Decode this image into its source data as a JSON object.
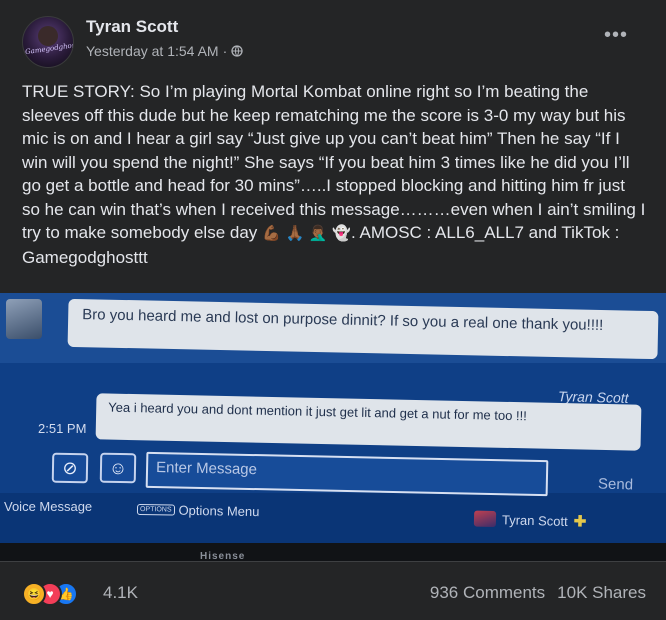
{
  "post": {
    "author": "Tyran Scott",
    "timestamp": "Yesterday at 1:54 AM",
    "separator": "·",
    "avatar_text": "Gamegodghost",
    "more_icon": "more-horizontal-icon",
    "text": "TRUE STORY:  So I’m playing Mortal Kombat online right so I’m beating the sleeves off this dude but he keep rematching me the score is 3-0 my way but his mic is on and I hear a girl say “Just give up you can’t beat him” Then he say “If I win will you spend the night!” She says “If you beat him 3 times like he did you I’ll go get a bottle and head for 30 mins”…..I stopped blocking and hitting him fr just so he can win that’s when I received this message………even when I ain’t smiling I try to make somebody else day",
    "emojis": [
      "💪🏾",
      "🙏🏾",
      "🤦🏾‍♂️",
      "👻"
    ],
    "text_tail": ". AMOSC : ALL6_ALL7 and TikTok : Gamegodghosttt"
  },
  "screenshot": {
    "received_message": "Bro you heard me and lost on purpose dinnit? If so you a real one thank you!!!!",
    "sender_name": "Tyran Scott",
    "sent_message": "Yea i heard you and dont mention it just get lit and get a nut for me too !!!",
    "sent_time": "2:51 PM",
    "input_placeholder": "Enter Message",
    "send_label": "Send",
    "voice_message_label": "Voice Message",
    "options_badge": "OPTIONS",
    "options_label": "Options Menu",
    "footer_user": "Tyran Scott",
    "footer_plus": "✚",
    "tv_brand": "Hisense"
  },
  "footer": {
    "reaction_count": "4.1K",
    "comments": "936 Comments",
    "shares": "10K Shares",
    "reactions": [
      {
        "icon": "haha-icon",
        "color": "#f7b125",
        "glyph": "😆"
      },
      {
        "icon": "love-icon",
        "color": "#f33e58",
        "glyph": "♥"
      },
      {
        "icon": "like-icon",
        "color": "#1877f2",
        "glyph": "👍"
      }
    ]
  },
  "colors": {
    "background": "#242526",
    "text_primary": "#e4e6eb",
    "text_secondary": "#b0b3b8",
    "ps_blue": "#0f3f86"
  }
}
